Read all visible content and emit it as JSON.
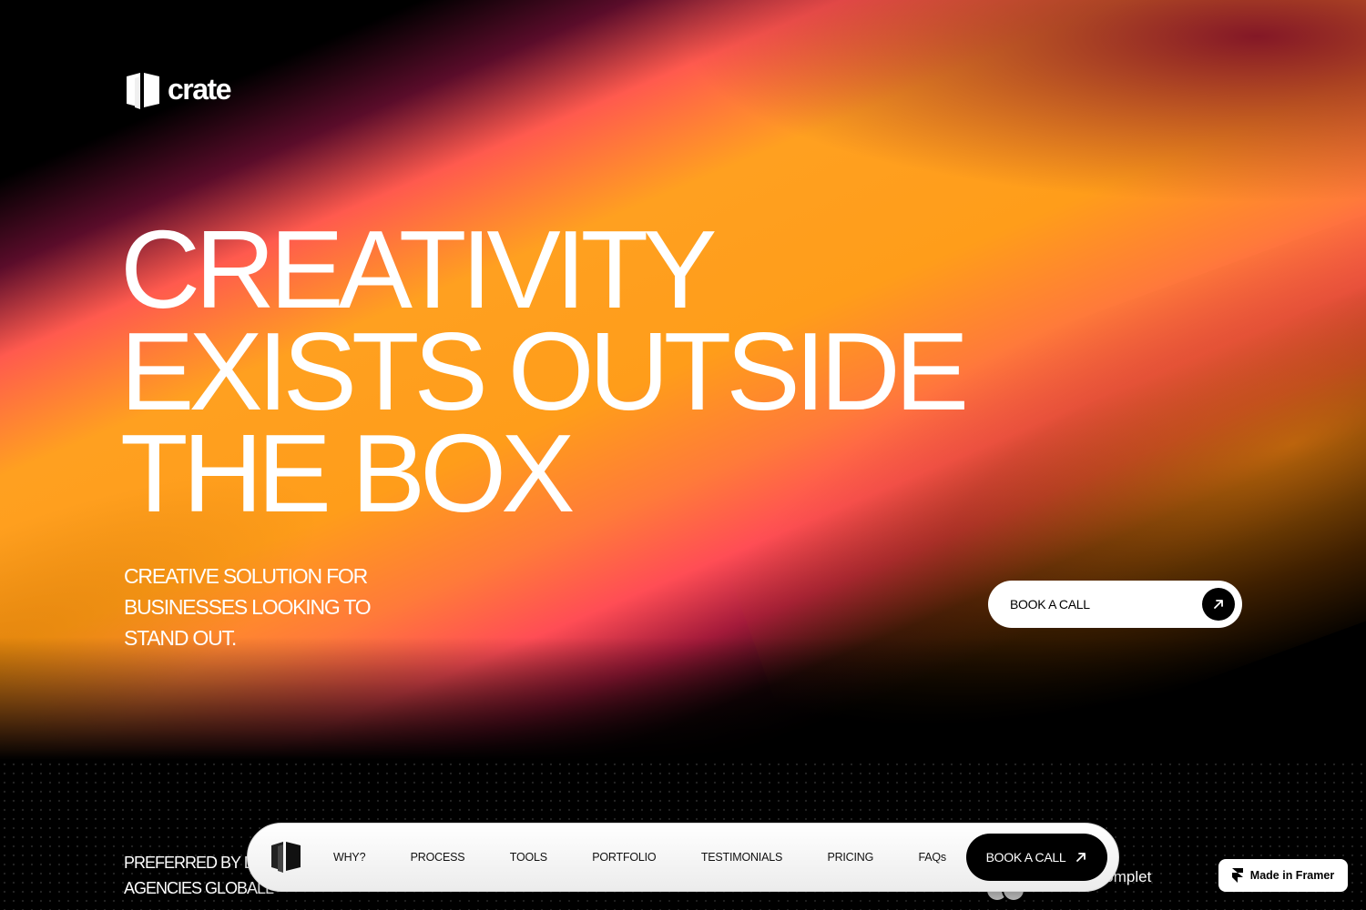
{
  "brand": {
    "name": "crate",
    "colors": {
      "accent_orange": "#ff9d1a",
      "accent_pink": "#ff5a4e",
      "background": "#000000"
    }
  },
  "hero": {
    "headline_lines": [
      "CREATIVITY",
      "EXISTS OUTSIDE",
      "THE BOX"
    ],
    "subhead": "CREATIVE SOLUTION FOR BUSINESSES LOOKING TO STAND OUT.",
    "cta_label": "BOOK A CALL",
    "cta_icon": "arrow-up-right-icon"
  },
  "social_proof": {
    "preferred_text": "PREFERRED BY D",
    "preferred_text_line2": "AGENCIES GLOBALL",
    "projects_text": "rojects complet"
  },
  "nav": {
    "logo_icon": "crate-logo-icon",
    "items": [
      {
        "label": "WHY?"
      },
      {
        "label": "PROCESS"
      },
      {
        "label": "TOOLS"
      },
      {
        "label": "PORTFOLIO"
      },
      {
        "label": "TESTIMONIALS"
      },
      {
        "label": "PRICING"
      },
      {
        "label": "FAQs"
      }
    ],
    "cta_label": "BOOK A CALL",
    "cta_icon": "arrow-up-right-icon"
  },
  "framer_badge": {
    "label": "Made in Framer",
    "icon": "framer-logo-icon"
  }
}
